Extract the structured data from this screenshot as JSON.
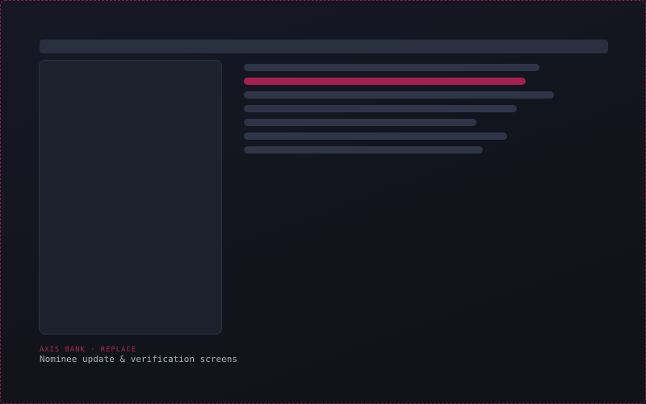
{
  "caption": {
    "kicker": "AXIS BANK · REPLACE",
    "title": "Nominee update & verification screens"
  },
  "colors": {
    "background": "#12141d",
    "frame_border": "#8a1f4f",
    "placeholder": "#2f3547",
    "accent": "#a3204f",
    "panel": "#1c212d"
  }
}
